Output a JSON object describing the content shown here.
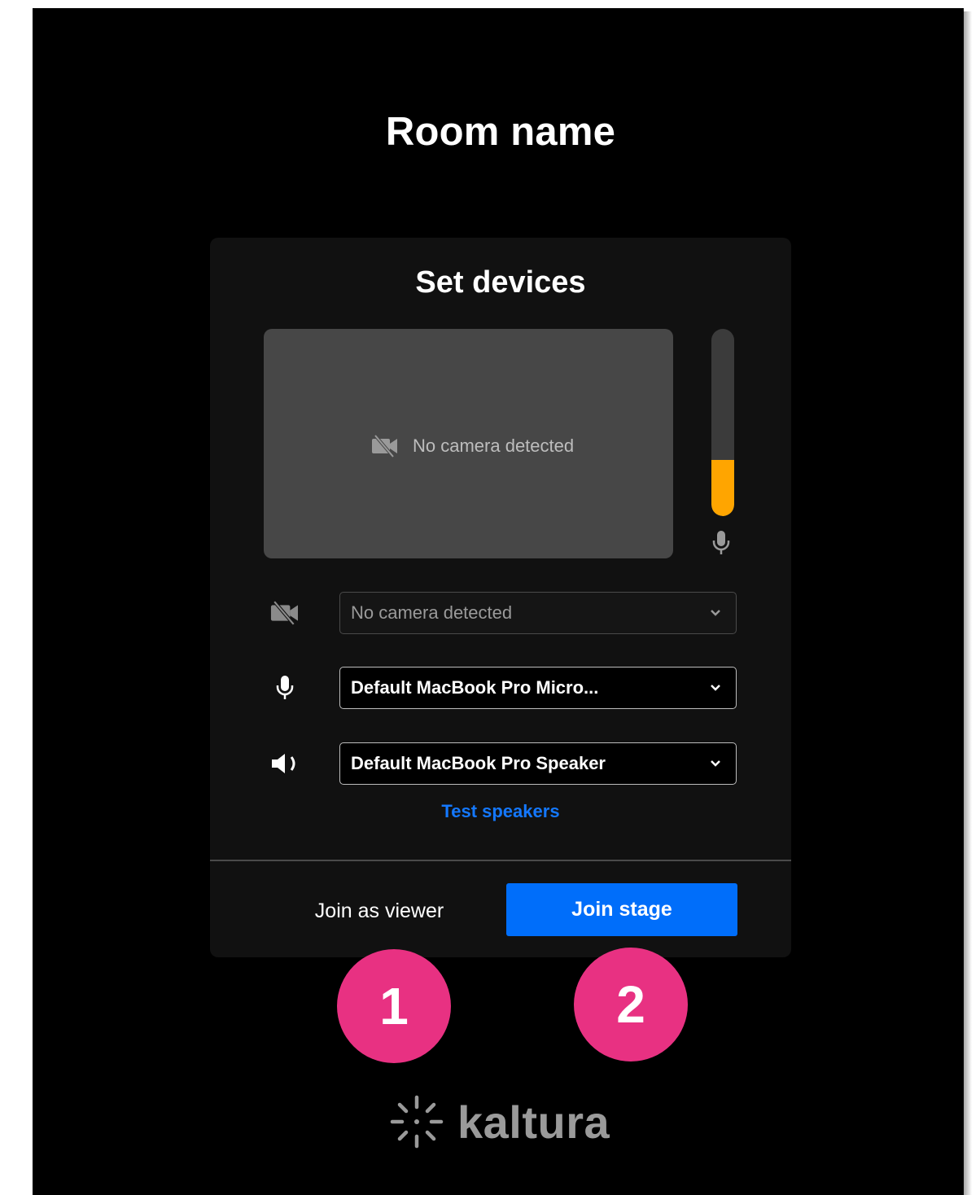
{
  "room": {
    "title": "Room name"
  },
  "devices": {
    "title": "Set devices",
    "preview_message": "No camera detected",
    "mic_level_fraction": 0.3,
    "camera_select": {
      "value": "No camera detected",
      "disabled": true
    },
    "mic_select": {
      "value": "Default MacBook Pro Micro..."
    },
    "speaker_select": {
      "value": "Default MacBook Pro Speaker"
    },
    "test_speakers_label": "Test speakers"
  },
  "actions": {
    "join_viewer_label": "Join as viewer",
    "join_stage_label": "Join stage"
  },
  "callouts": [
    {
      "label": "1"
    },
    {
      "label": "2"
    }
  ],
  "logo": {
    "text": "kaltura"
  },
  "icons": {
    "camera_off": "camera-off-icon",
    "microphone": "microphone-icon",
    "speaker": "speaker-icon",
    "chevron": "chevron-down-icon",
    "logo": "kaltura-logo-icon"
  },
  "colors": {
    "background": "#000000",
    "card": "#111111",
    "accent": "#006efa",
    "link": "#1478ff",
    "meter": "#ffa500",
    "callout": "#e83182"
  }
}
